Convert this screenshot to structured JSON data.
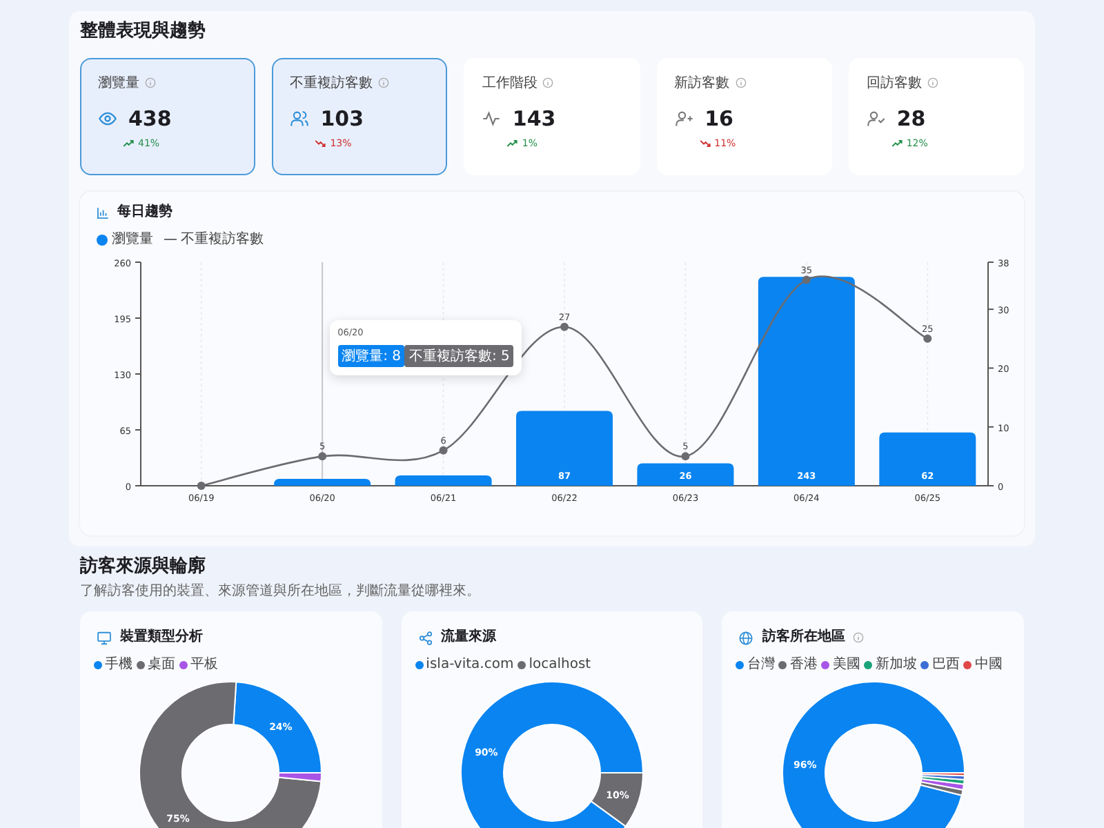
{
  "overview": {
    "title": "整體表現與趨勢",
    "kpis": [
      {
        "label": "瀏覽量",
        "value": "438",
        "change": "41%",
        "up": true,
        "selected": true,
        "kind": "eye"
      },
      {
        "label": "不重複訪客數",
        "value": "103",
        "change": "13%",
        "up": false,
        "selected": true,
        "kind": "users"
      },
      {
        "label": "工作階段",
        "value": "143",
        "change": "1%",
        "up": true,
        "selected": false,
        "kind": "activity"
      },
      {
        "label": "新訪客數",
        "value": "16",
        "change": "11%",
        "up": false,
        "selected": false,
        "kind": "user-plus"
      },
      {
        "label": "回訪客數",
        "value": "28",
        "change": "12%",
        "up": true,
        "selected": false,
        "kind": "user-check"
      }
    ],
    "daily_trend": {
      "title": "每日趨勢",
      "tooltip": {
        "title": "06/20",
        "items": [
          "瀏覽量: 8",
          "不重複訪客數: 5"
        ]
      },
      "chart_data": {
        "type": "bar",
        "categories": [
          "06/19",
          "06/20",
          "06/21",
          "06/22",
          "06/23",
          "06/24",
          "06/25"
        ],
        "series": [
          {
            "name": "瀏覽量",
            "type": "bar",
            "color": "#0a84f0",
            "values": [
              0,
              8,
              12,
              87,
              26,
              243,
              62
            ],
            "value_labels": [
              null,
              null,
              null,
              "87",
              "26",
              "243",
              "62"
            ]
          },
          {
            "name": "不重複訪客數",
            "type": "line",
            "axis": "y2",
            "marker": true,
            "color": "#6b6b70",
            "values": [
              0,
              5,
              6,
              27,
              5,
              35,
              25
            ],
            "value_labels": [
              null,
              "5",
              "6",
              "27",
              "5",
              "35",
              "25"
            ]
          }
        ],
        "ylim": [
          0,
          260
        ],
        "yticks": [
          0,
          65,
          130,
          195,
          260
        ],
        "y2lim": [
          0,
          38
        ],
        "y2ticks": [
          0,
          10,
          20,
          30,
          38
        ],
        "grid": true,
        "ref_lines": [
          {
            "axis": "x",
            "value": "06/20",
            "color": "#c8c8cc"
          }
        ]
      }
    }
  },
  "sources": {
    "title": "訪客來源與輪廓",
    "subtitle": "了解訪客使用的裝置、來源管道與所在地區，判斷流量從哪裡來。",
    "cards": [
      {
        "title": "裝置類型分析",
        "kind": "monitor",
        "info": false,
        "chart_data": {
          "type": "donut",
          "categories": [
            "手機",
            "桌面",
            "平板"
          ],
          "colors": [
            "#0a84f0",
            "#6b6b70",
            "#a855e6"
          ],
          "values": [
            24,
            74.5,
            1.5
          ],
          "value_labels": [
            "24%",
            "75%",
            null
          ]
        }
      },
      {
        "title": "流量來源",
        "kind": "share",
        "info": false,
        "chart_data": {
          "type": "donut",
          "categories": [
            "isla-vita.com",
            "localhost"
          ],
          "colors": [
            "#0a84f0",
            "#6b6b70"
          ],
          "values": [
            90,
            10
          ],
          "value_labels": [
            "90%",
            "10%"
          ]
        }
      },
      {
        "title": "訪客所在地區",
        "kind": "globe",
        "info": true,
        "chart_data": {
          "type": "donut",
          "categories": [
            "台灣",
            "香港",
            "美國",
            "新加坡",
            "巴西",
            "中國"
          ],
          "colors": [
            "#0a84f0",
            "#6b6b70",
            "#a855e6",
            "#1aa37a",
            "#3b6fd6",
            "#e04848"
          ],
          "values": [
            96,
            1,
            1,
            0.8,
            0.7,
            0.5
          ],
          "value_labels": [
            "96%",
            null,
            null,
            null,
            null,
            null
          ]
        }
      }
    ]
  }
}
